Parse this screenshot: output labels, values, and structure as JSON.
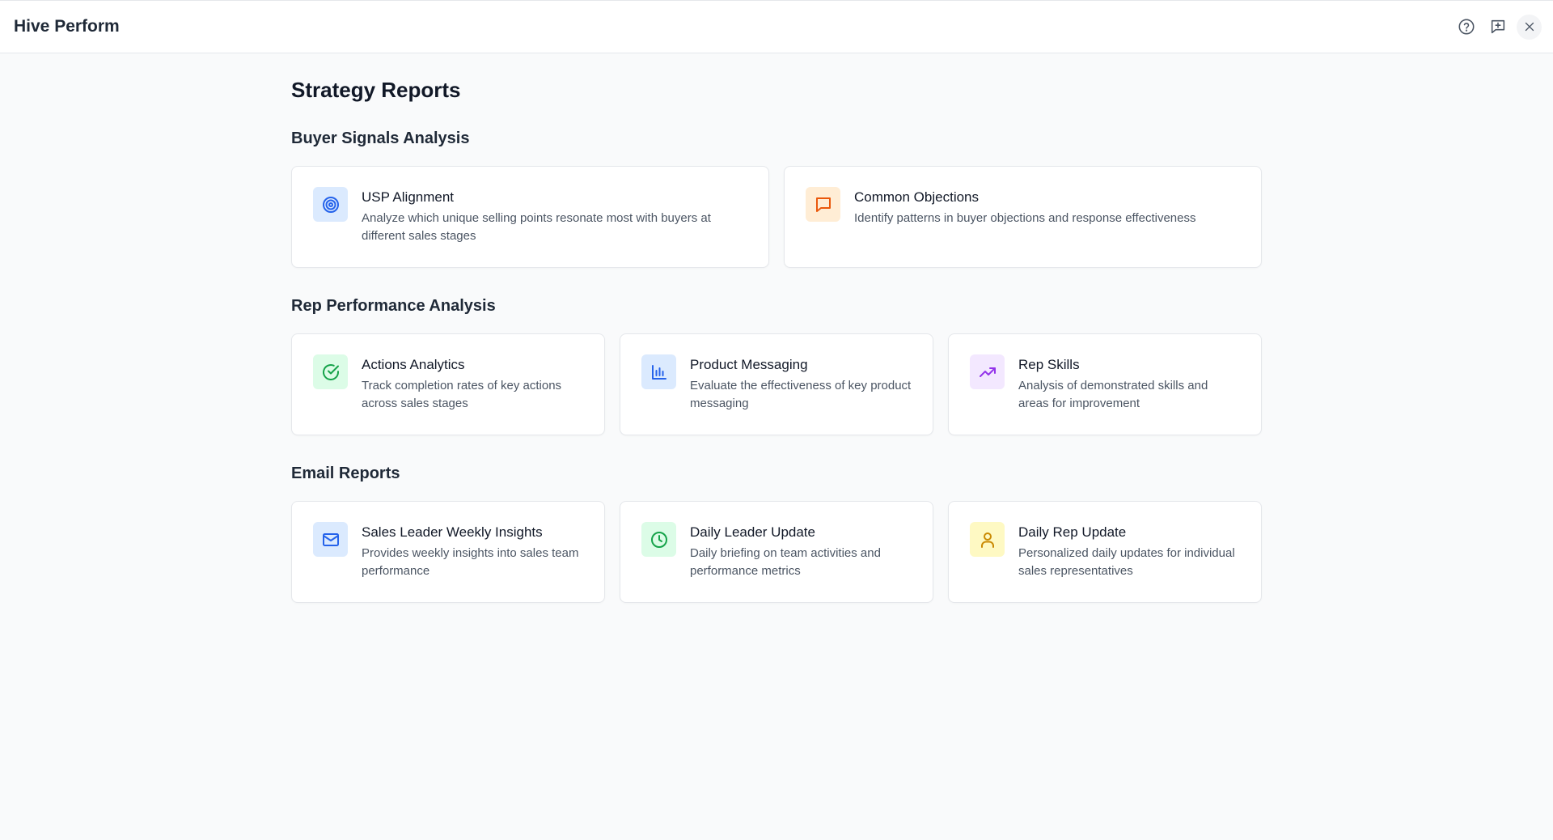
{
  "header": {
    "app_title": "Hive Perform",
    "help_icon": "question-circle-icon",
    "feedback_icon": "message-plus-icon",
    "close_icon": "close-icon"
  },
  "page": {
    "title": "Strategy Reports"
  },
  "sections": [
    {
      "title": "Buyer Signals Analysis",
      "cards": [
        {
          "title": "USP Alignment",
          "description": "Analyze which unique selling points resonate most with buyers at different sales stages",
          "icon": "target-icon",
          "color": "#2563eb"
        },
        {
          "title": "Common Objections",
          "description": "Identify patterns in buyer objections and response effectiveness",
          "icon": "message-square-icon",
          "color": "#ea580c"
        }
      ]
    },
    {
      "title": "Rep Performance Analysis",
      "cards": [
        {
          "title": "Actions Analytics",
          "description": "Track completion rates of key actions across sales stages",
          "icon": "check-circle-icon",
          "color": "#16a34a"
        },
        {
          "title": "Product Messaging",
          "description": "Evaluate the effectiveness of key product messaging",
          "icon": "bar-chart-icon",
          "color": "#2563eb"
        },
        {
          "title": "Rep Skills",
          "description": "Analysis of demonstrated skills and areas for improvement",
          "icon": "trending-up-icon",
          "color": "#9333ea"
        }
      ]
    },
    {
      "title": "Email Reports",
      "cards": [
        {
          "title": "Sales Leader Weekly Insights",
          "description": "Provides weekly insights into sales team performance",
          "icon": "mail-icon",
          "color": "#2563eb"
        },
        {
          "title": "Daily Leader Update",
          "description": "Daily briefing on team activities and performance metrics",
          "icon": "clock-icon",
          "color": "#16a34a"
        },
        {
          "title": "Daily Rep Update",
          "description": "Personalized daily updates for individual sales representatives",
          "icon": "user-icon",
          "color": "#ca8a04"
        }
      ]
    }
  ]
}
